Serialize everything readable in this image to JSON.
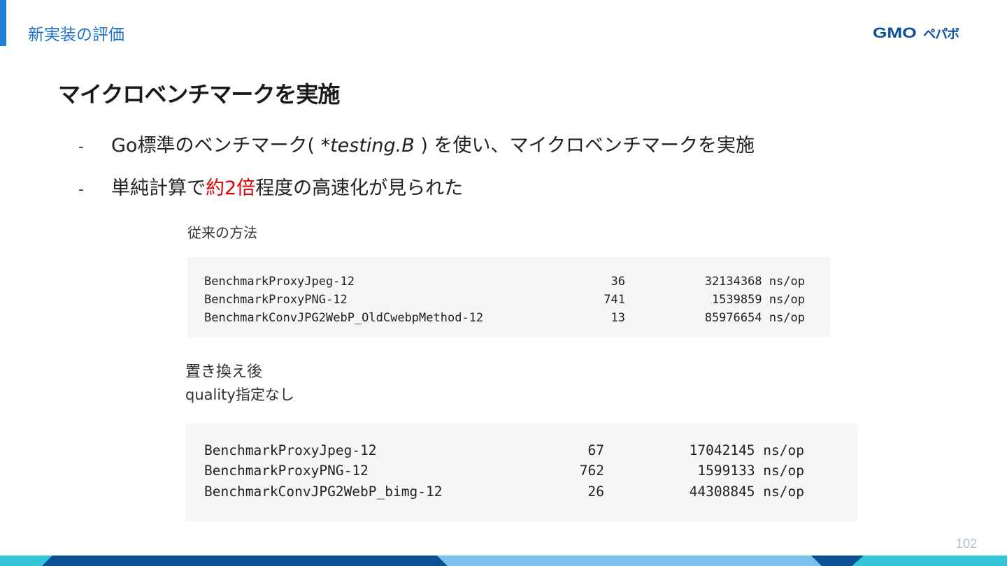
{
  "header": {
    "section_title": "新実装の評価"
  },
  "logo": {
    "gmo": "GMO",
    "kana": "ペパボ"
  },
  "headline": "マイクロベンチマークを実施",
  "bullets": [
    {
      "dash": "-",
      "before": "Go標準のベンチマーク( ",
      "code": "*testing.B",
      "after": " ) を使い、マイクロベンチマークを実施"
    },
    {
      "dash": "-",
      "before": "単純計算で",
      "highlight": "約2倍",
      "after": "程度の高速化が見られた"
    }
  ],
  "old_method": {
    "label": "従来の方法",
    "rows": [
      {
        "name": "BenchmarkProxyJpeg-12",
        "n": "36",
        "ns": "32134368 ns/op"
      },
      {
        "name": "BenchmarkProxyPNG-12",
        "n": "741",
        "ns": "1539859 ns/op"
      },
      {
        "name": "BenchmarkConvJPG2WebP_OldCwebpMethod-12",
        "n": "13",
        "ns": "85976654 ns/op"
      }
    ]
  },
  "new_method": {
    "label": "置き換え後",
    "sublabel": "quality指定なし",
    "rows": [
      {
        "name": "BenchmarkProxyJpeg-12",
        "n": "67",
        "ns": "17042145 ns/op"
      },
      {
        "name": "BenchmarkProxyPNG-12",
        "n": "762",
        "ns": "1599133 ns/op"
      },
      {
        "name": "BenchmarkConvJPG2WebP_bimg-12",
        "n": "26",
        "ns": "44308845 ns/op"
      }
    ]
  },
  "page_number": "102",
  "colors": {
    "accent": "#1e7fd6",
    "highlight": "#e00000",
    "footer_dark": "#0d4f94",
    "footer_light": "#7cc0ec",
    "footer_teal": "#33c4d6"
  }
}
